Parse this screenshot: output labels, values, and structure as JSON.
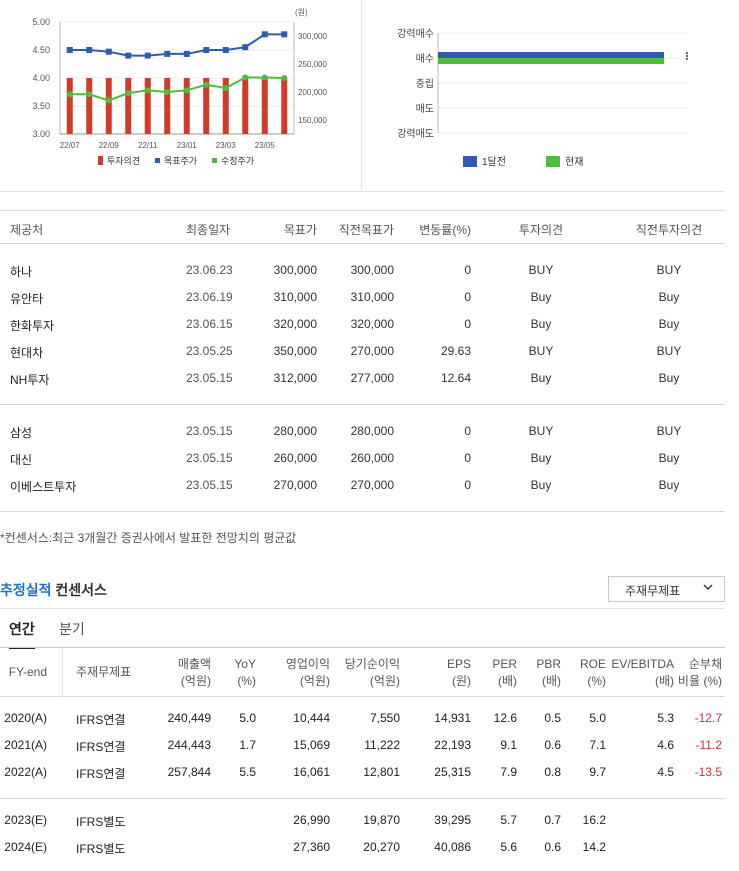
{
  "chart_data": [
    {
      "type": "bar",
      "x": [
        "22/07",
        "22/08",
        "22/09",
        "22/10",
        "22/11",
        "22/12",
        "23/01",
        "23/02",
        "23/03",
        "23/04",
        "23/05",
        "23/06"
      ],
      "xticks": [
        "22/07",
        "22/09",
        "22/11",
        "23/01",
        "23/03",
        "23/05"
      ],
      "unit_label": "(원)",
      "yleft_ticks": [
        "5.00",
        "4.50",
        "4.00",
        "3.50",
        "3.00"
      ],
      "yleft_lim": [
        3.0,
        5.0
      ],
      "yright_ticks": [
        "300,000",
        "250,000",
        "200,000",
        "150,000"
      ],
      "yright_lim": [
        125000,
        325000
      ],
      "series": [
        {
          "name": "투자의견",
          "axis": "left",
          "kind": "bar",
          "color": "#d03b2a",
          "values": [
            4.0,
            4.0,
            4.0,
            4.0,
            4.0,
            4.0,
            4.0,
            4.0,
            4.0,
            4.0,
            4.0,
            4.0
          ]
        },
        {
          "name": "목표주가",
          "axis": "right",
          "kind": "line",
          "color": "#2d5cb0",
          "values": [
            275000,
            275000,
            272000,
            265000,
            265000,
            268000,
            268000,
            275000,
            275000,
            280000,
            303000,
            303000
          ]
        },
        {
          "name": "수정주가",
          "axis": "right",
          "kind": "line",
          "color": "#4cbe3c",
          "values": [
            196000,
            196000,
            185000,
            198000,
            203000,
            200000,
            203000,
            213000,
            207000,
            226000,
            226000,
            225000
          ]
        }
      ]
    },
    {
      "type": "bar",
      "categories": [
        "강력매수",
        "매수",
        "중립",
        "매도",
        "강력매도"
      ],
      "series": [
        {
          "name": "1달전",
          "color": "#2d5cb0",
          "value": "매수"
        },
        {
          "name": "현재",
          "color": "#4cbe3c",
          "value": "매수"
        }
      ]
    }
  ],
  "opinions": {
    "headers": {
      "name": "제공처",
      "date": "최종일자",
      "target": "목표가",
      "prev_target": "직전목표가",
      "change": "변동률(%)",
      "opinion": "투자의견",
      "prev_opinion": "직전투자의견"
    },
    "group1": [
      {
        "name": "하나",
        "date": "23.06.23",
        "target": "300,000",
        "prev_target": "300,000",
        "change": "0",
        "opinion": "BUY",
        "prev_opinion": "BUY"
      },
      {
        "name": "유안타",
        "date": "23.06.19",
        "target": "310,000",
        "prev_target": "310,000",
        "change": "0",
        "opinion": "Buy",
        "prev_opinion": "Buy"
      },
      {
        "name": "한화투자",
        "date": "23.06.15",
        "target": "320,000",
        "prev_target": "320,000",
        "change": "0",
        "opinion": "Buy",
        "prev_opinion": "Buy"
      },
      {
        "name": "현대차",
        "date": "23.05.25",
        "target": "350,000",
        "prev_target": "270,000",
        "change": "29.63",
        "opinion": "BUY",
        "prev_opinion": "BUY"
      },
      {
        "name": "NH투자",
        "date": "23.05.15",
        "target": "312,000",
        "prev_target": "277,000",
        "change": "12.64",
        "opinion": "Buy",
        "prev_opinion": "Buy"
      }
    ],
    "group2": [
      {
        "name": "삼성",
        "date": "23.05.15",
        "target": "280,000",
        "prev_target": "280,000",
        "change": "0",
        "opinion": "BUY",
        "prev_opinion": "BUY"
      },
      {
        "name": "대신",
        "date": "23.05.15",
        "target": "260,000",
        "prev_target": "260,000",
        "change": "0",
        "opinion": "Buy",
        "prev_opinion": "Buy"
      },
      {
        "name": "이베스트투자",
        "date": "23.05.15",
        "target": "270,000",
        "prev_target": "270,000",
        "change": "0",
        "opinion": "Buy",
        "prev_opinion": "Buy"
      }
    ]
  },
  "note": "*컨센서스:최근 3개월간 증권사에서 발표한 전망치의 평균값",
  "section": {
    "title_blue": "추정실적",
    "title_black": "컨센서스",
    "dropdown": "주재무제표",
    "dropdown_icon": "chevron-down-icon"
  },
  "tabs": [
    {
      "label": "연간",
      "active": true
    },
    {
      "label": "분기",
      "active": false
    }
  ],
  "estimates": {
    "headers": [
      [
        "FY-end"
      ],
      [
        "주재무제표"
      ],
      [
        "매출액",
        "(억원)"
      ],
      [
        "YoY",
        "(%)"
      ],
      [
        "영업이익",
        "(억원)"
      ],
      [
        "당기순이익",
        "(억원)"
      ],
      [
        "EPS",
        "(원)"
      ],
      [
        "PER",
        "(배)"
      ],
      [
        "PBR",
        "(배)"
      ],
      [
        "ROE",
        "(%)"
      ],
      [
        "EV/EBITDA",
        "(배)"
      ],
      [
        "순부채",
        "비율 (%)"
      ]
    ],
    "rows": [
      [
        "2020(A)",
        "IFRS연결",
        "240,449",
        "5.0",
        "10,444",
        "7,550",
        "14,931",
        "12.6",
        "0.5",
        "5.0",
        "5.3",
        "-12.7"
      ],
      [
        "2021(A)",
        "IFRS연결",
        "244,443",
        "1.7",
        "15,069",
        "11,222",
        "22,193",
        "9.1",
        "0.6",
        "7.1",
        "4.6",
        "-11.2"
      ],
      [
        "2022(A)",
        "IFRS연결",
        "257,844",
        "5.5",
        "16,061",
        "12,801",
        "25,315",
        "7.9",
        "0.8",
        "9.7",
        "4.5",
        "-13.5"
      ],
      [
        "2023(E)",
        "IFRS별도",
        "",
        "",
        "26,990",
        "19,870",
        "39,295",
        "5.7",
        "0.7",
        "16.2",
        "",
        ""
      ],
      [
        "2024(E)",
        "IFRS별도",
        "",
        "",
        "27,360",
        "20,270",
        "40,086",
        "5.6",
        "0.6",
        "14.2",
        "",
        ""
      ]
    ]
  }
}
